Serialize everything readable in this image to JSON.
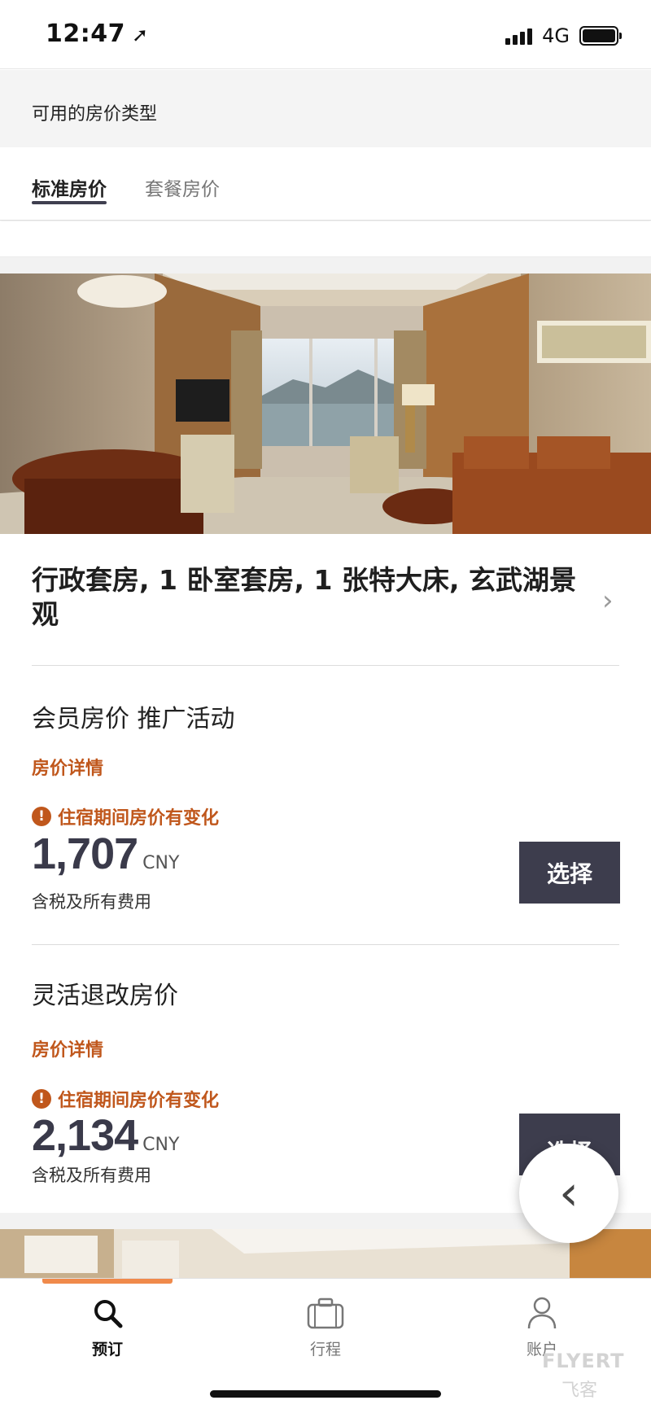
{
  "status_bar": {
    "time": "12:47",
    "network": "4G"
  },
  "rate_types": {
    "title": "可用的房价类型",
    "tabs": [
      {
        "label": "标准房价",
        "active": true
      },
      {
        "label": "套餐房价",
        "active": false
      }
    ]
  },
  "room": {
    "name": "行政套房, 1 卧室套房, 1  张特大床, 玄武湖景观"
  },
  "rate_plans": [
    {
      "title": "会员房价 推广活动",
      "details_link": "房价详情",
      "warning": "住宿期间房价有变化",
      "price": "1,707",
      "currency": "CNY",
      "tax_note": "含税及所有费用",
      "select_label": "选择"
    },
    {
      "title": "灵活退改房价",
      "details_link": "房价详情",
      "warning": "住宿期间房价有变化",
      "price": "2,134",
      "currency": "CNY",
      "tax_note": "含税及所有费用",
      "select_label": "选择"
    }
  ],
  "bottom_nav": [
    {
      "label": "预订",
      "icon": "search-icon",
      "active": true
    },
    {
      "label": "行程",
      "icon": "briefcase-icon",
      "active": false
    },
    {
      "label": "账户",
      "icon": "person-icon",
      "active": false
    }
  ],
  "watermark": {
    "brand": "FLYERT",
    "sub": "飞客"
  },
  "colors": {
    "accent": "#c0571c",
    "button": "#3d3d4d",
    "nav_indicator": "#f08a4b"
  }
}
